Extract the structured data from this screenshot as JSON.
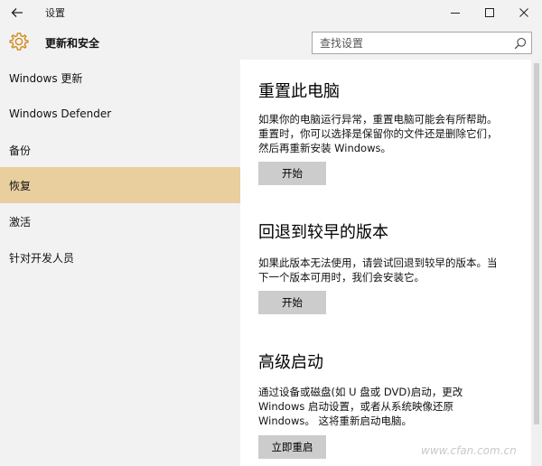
{
  "titlebar": {
    "title": "设置",
    "back_icon": "arrow-left-icon",
    "minimize_icon": "minimize-icon",
    "maximize_icon": "maximize-icon",
    "close_icon": "close-icon"
  },
  "header": {
    "icon": "gear-icon",
    "title": "更新和安全",
    "search_placeholder": "查找设置",
    "search_icon": "search-icon"
  },
  "sidebar": {
    "items": [
      {
        "label": "Windows 更新",
        "selected": false
      },
      {
        "label": "Windows Defender",
        "selected": false
      },
      {
        "label": "备份",
        "selected": false
      },
      {
        "label": "恢复",
        "selected": true
      },
      {
        "label": "激活",
        "selected": false
      },
      {
        "label": "针对开发人员",
        "selected": false
      }
    ],
    "selected_color": "#e9cf9e"
  },
  "main": {
    "sections": [
      {
        "title": "重置此电脑",
        "lines": [
          "如果你的电脑运行异常，重置电脑可能会有所帮助。",
          "重置时，你可以选择是保留你的文件还是删除它们，",
          "然后再重新安装 Windows。"
        ],
        "button": "开始"
      },
      {
        "title": "回退到较早的版本",
        "lines": [
          "如果此版本无法使用，请尝试回退到较早的版本。当",
          "下一个版本可用时，我们会安装它。"
        ],
        "button": "开始"
      },
      {
        "title": "高级启动",
        "lines": [
          "通过设备或磁盘(如 U 盘或 DVD)启动，更改",
          "Windows 启动设置，或者从系统映像还原",
          "Windows。 这将重新启动电脑。"
        ],
        "button": "立即重启"
      }
    ]
  },
  "watermark": "www.cfan.com.cn"
}
